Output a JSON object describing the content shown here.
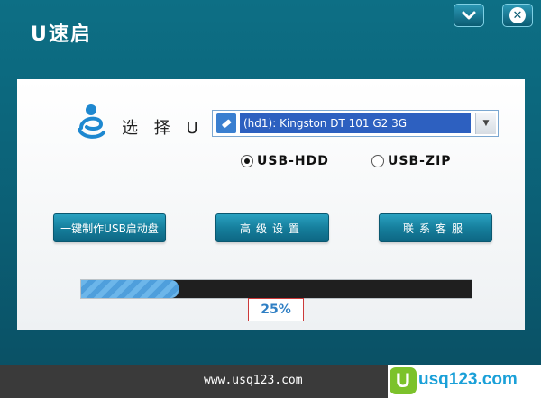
{
  "window": {
    "title": "U速启",
    "minimize_icon": "chevron-down-icon",
    "close_icon": "close-icon"
  },
  "panel": {
    "select_label": "选 择 U 盘",
    "drive_value": "(hd1): Kingston DT 101 G2 3G",
    "radio_hdd": "USB-HDD",
    "radio_zip": "USB-ZIP",
    "selected_mode": "USB-HDD",
    "make_button": "一键制作USB启动盘",
    "advanced_button": "高级设置",
    "contact_button": "联系客服",
    "progress_fraction": 0.25,
    "progress_text": "25%"
  },
  "footer": {
    "url": "www.usq123.com",
    "brand_letter": "U",
    "brand_text": "usq123.com"
  },
  "colors": {
    "background": "#0d6f85",
    "button": "#167f9d",
    "progress_fill": "#5aa8e2",
    "progress_text": "#2f7fc4"
  }
}
